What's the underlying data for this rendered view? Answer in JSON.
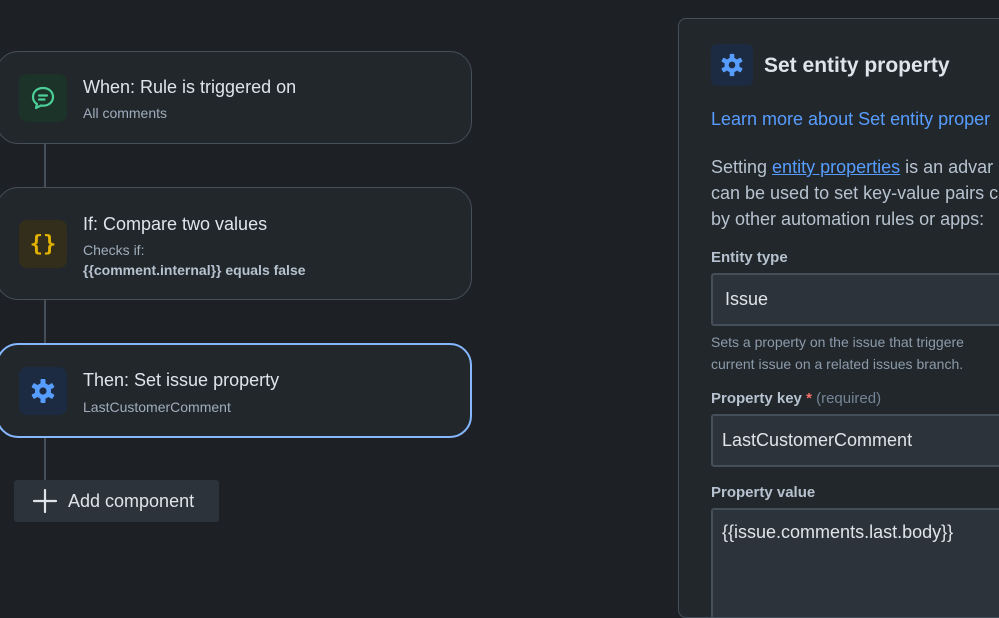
{
  "flow": {
    "trigger": {
      "title": "When: Rule is triggered on",
      "subtitle": "All comments",
      "icon": "comment-icon",
      "color": "#4bce97"
    },
    "condition": {
      "title": "If: Compare two values",
      "subtitle": "Checks if:",
      "detail": "{{comment.internal}} equals false",
      "icon": "braces-icon",
      "color": "#e2b203"
    },
    "action": {
      "title": "Then: Set issue property",
      "subtitle": "LastCustomerComment",
      "icon": "gear-icon",
      "color": "#579dff"
    },
    "add_label": "Add component"
  },
  "panel": {
    "title": "Set entity property",
    "icon": "gear-icon",
    "learn_more": "Learn more about Set entity proper",
    "desc_line1_pre": "Setting ",
    "desc_line1_link": "entity properties",
    "desc_line1_post": " is an advar",
    "desc_line2": "can be used to set key-value pairs c",
    "desc_line3": "by other automation rules or apps:",
    "entity_type_label": "Entity type",
    "entity_type_value": "Issue",
    "entity_help_1": "Sets a property on the issue that triggere",
    "entity_help_2": "current issue on a related issues branch.",
    "key_label": "Property key",
    "key_star": "*",
    "key_required": "(required)",
    "key_value": "LastCustomerComment",
    "value_label": "Property value",
    "value_value": "{{issue.comments.last.body}}"
  }
}
